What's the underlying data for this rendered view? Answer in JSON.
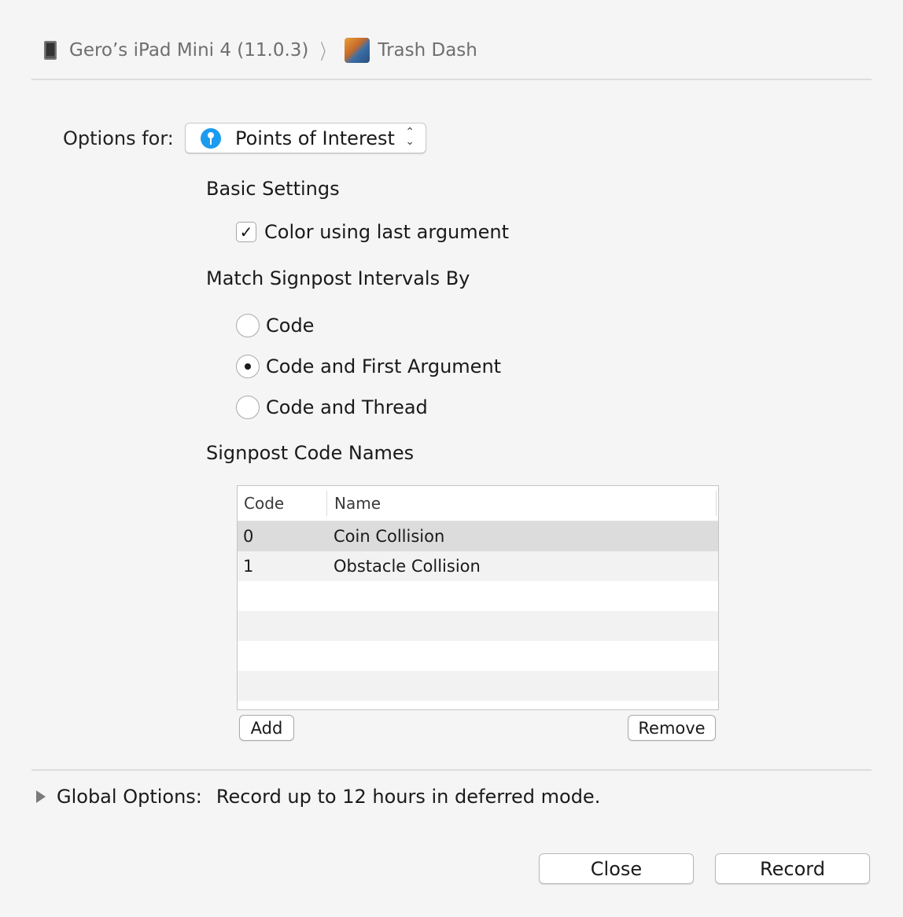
{
  "breadcrumb": {
    "device": "Gero’s iPad Mini 4 (11.0.3)",
    "device_icon": "ipad-icon",
    "separator": "〉",
    "app": "Trash Dash",
    "app_icon": "trash-dash-app-icon"
  },
  "options": {
    "label": "Options for:",
    "selected": "Points of Interest",
    "selected_icon": "points-of-interest-icon"
  },
  "basic_settings": {
    "heading": "Basic Settings",
    "color_checkbox": {
      "label": "Color using last argument",
      "checked": true,
      "mark": "✓"
    }
  },
  "match": {
    "heading": "Match Signpost Intervals By",
    "options": [
      {
        "label": "Code",
        "selected": false
      },
      {
        "label": "Code and First Argument",
        "selected": true
      },
      {
        "label": "Code and Thread",
        "selected": false
      }
    ]
  },
  "code_names": {
    "heading": "Signpost Code Names",
    "columns": [
      "Code",
      "Name"
    ],
    "rows": [
      {
        "code": "0",
        "name": "Coin Collision",
        "selected": true
      },
      {
        "code": "1",
        "name": "Obstacle Collision",
        "selected": false
      }
    ],
    "add_label": "Add",
    "remove_label": "Remove"
  },
  "global": {
    "label": "Global Options:",
    "value": "Record up to 12 hours in deferred mode."
  },
  "footer": {
    "close_label": "Close",
    "record_label": "Record"
  },
  "colors": {
    "accent_blue": "#1b9bf0",
    "background": "#f5f5f5",
    "selected_row": "#dcdcdc"
  }
}
